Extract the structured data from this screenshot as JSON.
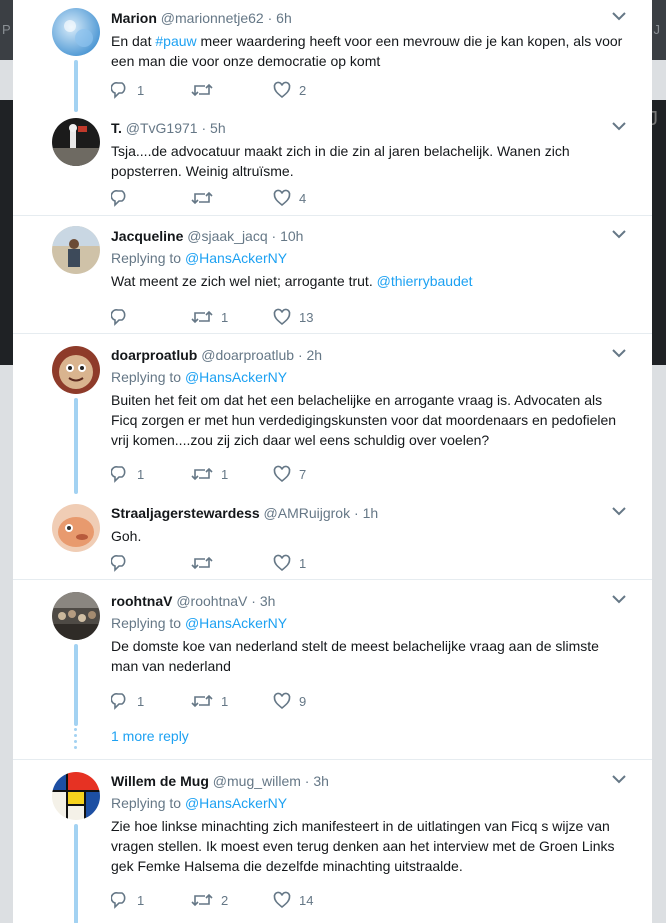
{
  "background": {
    "left_letter": "P",
    "right_letter": "J"
  },
  "replies": [
    {
      "name": "Marion",
      "handle": "@marionnetje62",
      "time": "6h",
      "text_parts": [
        "En dat ",
        "#pauw",
        " meer waardering heeft voor een mevrouw die je kan kopen, als voor een man die voor onze democratie op komt"
      ],
      "replies": "1",
      "retweets": "",
      "likes": "2"
    },
    {
      "name": "T.",
      "handle": "@TvG1971",
      "time": "5h",
      "text": "Tsja....de advocatuur maakt zich in die zin al jaren belachelijk. Wanen zich popsterren. Weinig altruïsme.",
      "replies": "",
      "retweets": "",
      "likes": "4"
    },
    {
      "name": "Jacqueline",
      "handle": "@sjaak_jacq",
      "time": "10h",
      "replying_label": "Replying to",
      "replying_to": "@HansAckerNY",
      "text": "Wat meent ze zich wel niet; arrogante trut.",
      "mention": "@thierrybaudet",
      "replies": "",
      "retweets": "1",
      "likes": "13"
    },
    {
      "name": "doarproatlub",
      "handle": "@doarproatlub",
      "time": "2h",
      "replying_label": "Replying to",
      "replying_to": "@HansAckerNY",
      "text": "Buiten het feit om dat het een belachelijke en arrogante vraag is. Advocaten als Ficq zorgen er met hun verdedigingskunsten voor dat moordenaars en pedofielen vrij komen....zou zij zich daar wel eens schuldig over voelen?",
      "replies": "1",
      "retweets": "1",
      "likes": "7"
    },
    {
      "name": "Straaljagerstewardess",
      "handle": "@AMRuijgrok",
      "time": "1h",
      "text": "Goh.",
      "replies": "",
      "retweets": "",
      "likes": "1"
    },
    {
      "name": "roohtnaV",
      "handle": "@roohtnaV",
      "time": "3h",
      "replying_label": "Replying to",
      "replying_to": "@HansAckerNY",
      "text": "De domste koe van nederland stelt de meest belachelijke vraag aan de slimste man van nederland",
      "replies": "1",
      "retweets": "1",
      "likes": "9",
      "more_replies": "1 more reply"
    },
    {
      "name": "Willem de Mug",
      "handle": "@mug_willem",
      "time": "3h",
      "replying_label": "Replying to",
      "replying_to": "@HansAckerNY",
      "text": "Zie hoe linkse minachting zich manifesteert in de uitlatingen van  Ficq s wijze van vragen stellen.  Ik moest even terug denken aan het interview met de Groen Links gek Femke Halsema die dezelfde minachting uitstraalde.",
      "replies": "1",
      "retweets": "2",
      "likes": "14"
    }
  ],
  "colors": {
    "link": "#1da1f2",
    "secondary_text": "#657786",
    "thread_line": "#a3d2f2",
    "separator": "#e6ecf0"
  },
  "icons": [
    "reply-icon",
    "retweet-icon",
    "heart-icon",
    "chevron-down-icon"
  ]
}
